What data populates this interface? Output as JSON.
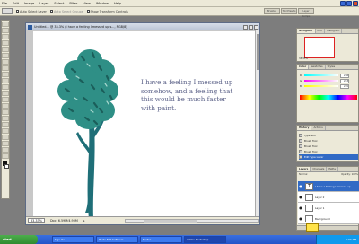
{
  "menubar": {
    "items": [
      "File",
      "Edit",
      "Image",
      "Layer",
      "Select",
      "Filter",
      "View",
      "Window",
      "Help"
    ]
  },
  "options_bar": {
    "auto_select": "Auto Select Layer",
    "auto_select_group": "Auto Select Groups",
    "show_transform": "Show Transform Controls",
    "palette_tabs": [
      "Brushes",
      "Tool Presets",
      "Layer Comps"
    ]
  },
  "document": {
    "title": "Untitled-1 @ 33.3% (I have a feeling I messed up s..., RGB/8)",
    "text": "I have a feeling I messed up\nsomehow, and a feeling that\nthis would be much faster\nwith paint.",
    "zoom": "33.33%",
    "doc_size": "Doc: 6.59M/4.90M"
  },
  "panels": {
    "navigator_tabs": [
      "Navigator",
      "Info",
      "Histogram"
    ],
    "navigator_zoom": "33.33%",
    "color_tabs": [
      "Color",
      "Swatches",
      "Styles"
    ],
    "color_rows": [
      {
        "label": "R",
        "value": "238"
      },
      {
        "label": "G",
        "value": "243"
      },
      {
        "label": "B",
        "value": "255"
      }
    ],
    "history_tabs": [
      "History",
      "Actions"
    ],
    "history_items": [
      "Type Tool",
      "Brush Tool",
      "Brush Tool",
      "Brush Tool",
      "Edit Type Layer"
    ],
    "layers_tabs": [
      "Layers",
      "Channels",
      "Paths"
    ],
    "layers_blend": "Normal",
    "layers_opacity": "Opacity: 100%",
    "layers_fill": "Fill: 100%",
    "layers": [
      {
        "name": "I have a feeling I messed up...",
        "thumb": "T"
      },
      {
        "name": "Layer 2",
        "thumb": ""
      },
      {
        "name": "Layer 1",
        "thumb": ""
      },
      {
        "name": "Background",
        "thumb": ""
      }
    ]
  },
  "taskbar": {
    "start": "start",
    "tasks": [
      "Sign On",
      "Photo Edit Software",
      "Firefox",
      "Adobe Photoshop"
    ],
    "clock": "2:34 PM"
  },
  "colors": {
    "tree_foliage": "#2f8f86",
    "tree_foliage_dark": "#1b5e5a",
    "tree_trunk": "#1f6f78",
    "text_color": "#5d6389",
    "selection_blue": "#316ac5"
  }
}
